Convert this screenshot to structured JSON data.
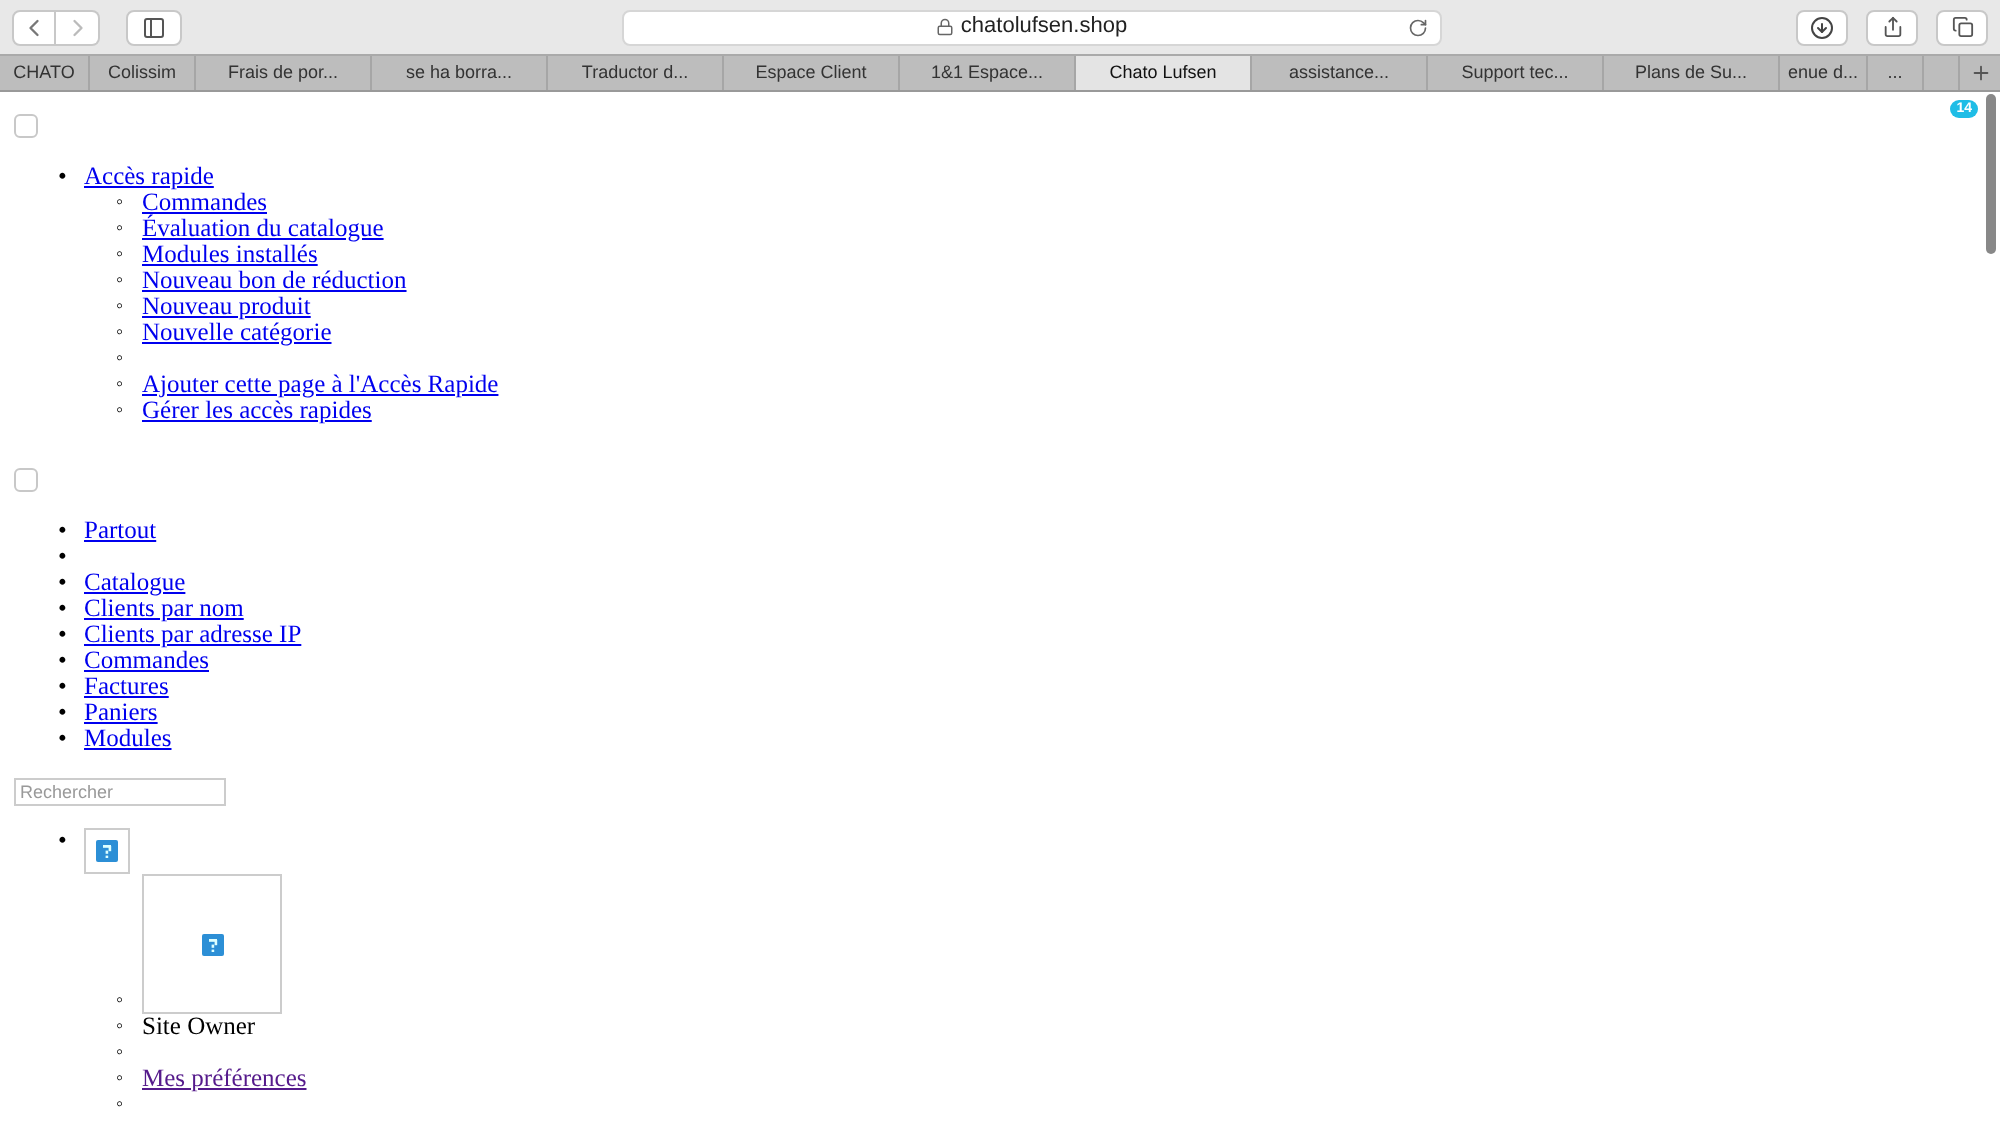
{
  "browser": {
    "address": "chatolufsen.shop",
    "tabs": [
      {
        "label": "CHATO",
        "selected": false
      },
      {
        "label": "Colissim",
        "selected": false
      },
      {
        "label": "Frais de por...",
        "selected": false
      },
      {
        "label": "se ha borra...",
        "selected": false
      },
      {
        "label": "Traductor d...",
        "selected": false
      },
      {
        "label": "Espace Client",
        "selected": false
      },
      {
        "label": "1&1 Espace...",
        "selected": false
      },
      {
        "label": "Chato Lufsen",
        "selected": true
      },
      {
        "label": "assistance...",
        "selected": false
      },
      {
        "label": "Support tec...",
        "selected": false
      },
      {
        "label": "Plans de Su...",
        "selected": false
      },
      {
        "label": "enue d...",
        "selected": false
      },
      {
        "label": "...",
        "selected": false
      }
    ]
  },
  "notification_badge": "14",
  "quick_access": {
    "checked": false,
    "items": [
      {
        "marker": "•",
        "kind": "link",
        "label": "Accès rapide",
        "children": [
          {
            "marker": "◦",
            "kind": "link",
            "label": "Commandes"
          },
          {
            "marker": "◦",
            "kind": "link",
            "label": "Évaluation du catalogue"
          },
          {
            "marker": "◦",
            "kind": "link",
            "label": "Modules installés"
          },
          {
            "marker": "◦",
            "kind": "link",
            "label": "Nouveau bon de réduction"
          },
          {
            "marker": "◦",
            "kind": "link",
            "label": "Nouveau produit"
          },
          {
            "marker": "◦",
            "kind": "link",
            "label": "Nouvelle catégorie"
          },
          {
            "marker": "◦",
            "kind": "blank"
          },
          {
            "marker": "◦",
            "kind": "link",
            "label": "Ajouter cette page à l'Accès Rapide"
          },
          {
            "marker": "◦",
            "kind": "link",
            "label": "Gérer les accès rapides"
          }
        ]
      }
    ]
  },
  "search_scope": {
    "checked": false,
    "items": [
      {
        "marker": "•",
        "kind": "link",
        "label": "Partout"
      },
      {
        "marker": "•",
        "kind": "blank"
      },
      {
        "marker": "•",
        "kind": "link",
        "label": "Catalogue"
      },
      {
        "marker": "•",
        "kind": "link",
        "label": "Clients par nom"
      },
      {
        "marker": "•",
        "kind": "link",
        "label": "Clients par adresse IP"
      },
      {
        "marker": "•",
        "kind": "link",
        "label": "Commandes"
      },
      {
        "marker": "•",
        "kind": "link",
        "label": "Factures"
      },
      {
        "marker": "•",
        "kind": "link",
        "label": "Paniers"
      },
      {
        "marker": "•",
        "kind": "link",
        "label": "Modules"
      }
    ]
  },
  "search": {
    "placeholder": "Rechercher"
  },
  "employee_menu": {
    "items": [
      {
        "marker": "•",
        "kind": "image",
        "children": [
          {
            "marker": "◦",
            "kind": "avatar"
          },
          {
            "marker": "◦",
            "kind": "text",
            "label": "Site Owner"
          },
          {
            "marker": "◦",
            "kind": "blank"
          },
          {
            "marker": "◦",
            "kind": "link",
            "label": " Mes préférences",
            "visited": true
          },
          {
            "marker": "◦",
            "kind": "blank"
          }
        ]
      }
    ]
  }
}
